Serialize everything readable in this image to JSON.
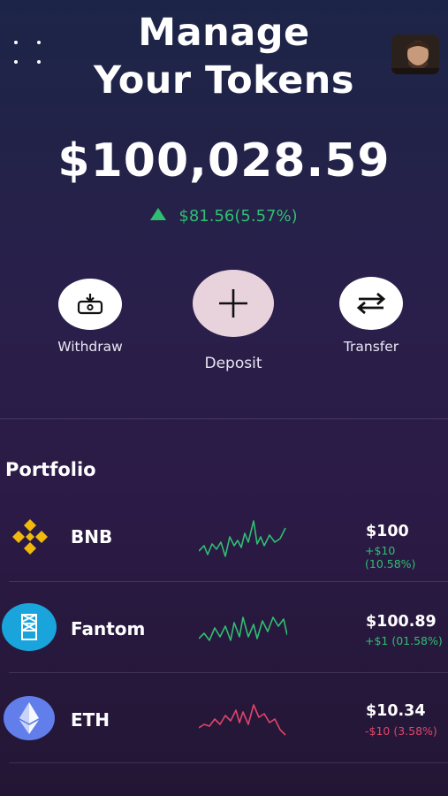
{
  "header": {
    "title_line1": "Manage",
    "title_line2": "Your Tokens"
  },
  "balance": {
    "total": "$100,028.59",
    "change": "$81.56(5.57%)",
    "direction": "up",
    "color_up": "#2fbf71"
  },
  "actions": [
    {
      "label": "Withdraw",
      "icon": "withdraw-icon"
    },
    {
      "label": "Deposit",
      "icon": "plus-icon"
    },
    {
      "label": "Transfer",
      "icon": "swap-arrows-icon"
    }
  ],
  "portfolio": {
    "title": "Portfolio",
    "items": [
      {
        "name": "BNB",
        "price": "$100",
        "change": "+$10 (10.58%)",
        "trend": "up",
        "icon": "bnb-logo-icon",
        "color": "#2fbf71"
      },
      {
        "name": "Fantom",
        "price": "$100.89",
        "change": "+$1 (01.58%)",
        "trend": "up",
        "icon": "fantom-logo-icon",
        "color": "#2fbf71"
      },
      {
        "name": "ETH",
        "price": "$10.34",
        "change": "-$10 (3.58%)",
        "trend": "down",
        "icon": "ethereum-logo-icon",
        "color": "#e0456a"
      }
    ]
  }
}
